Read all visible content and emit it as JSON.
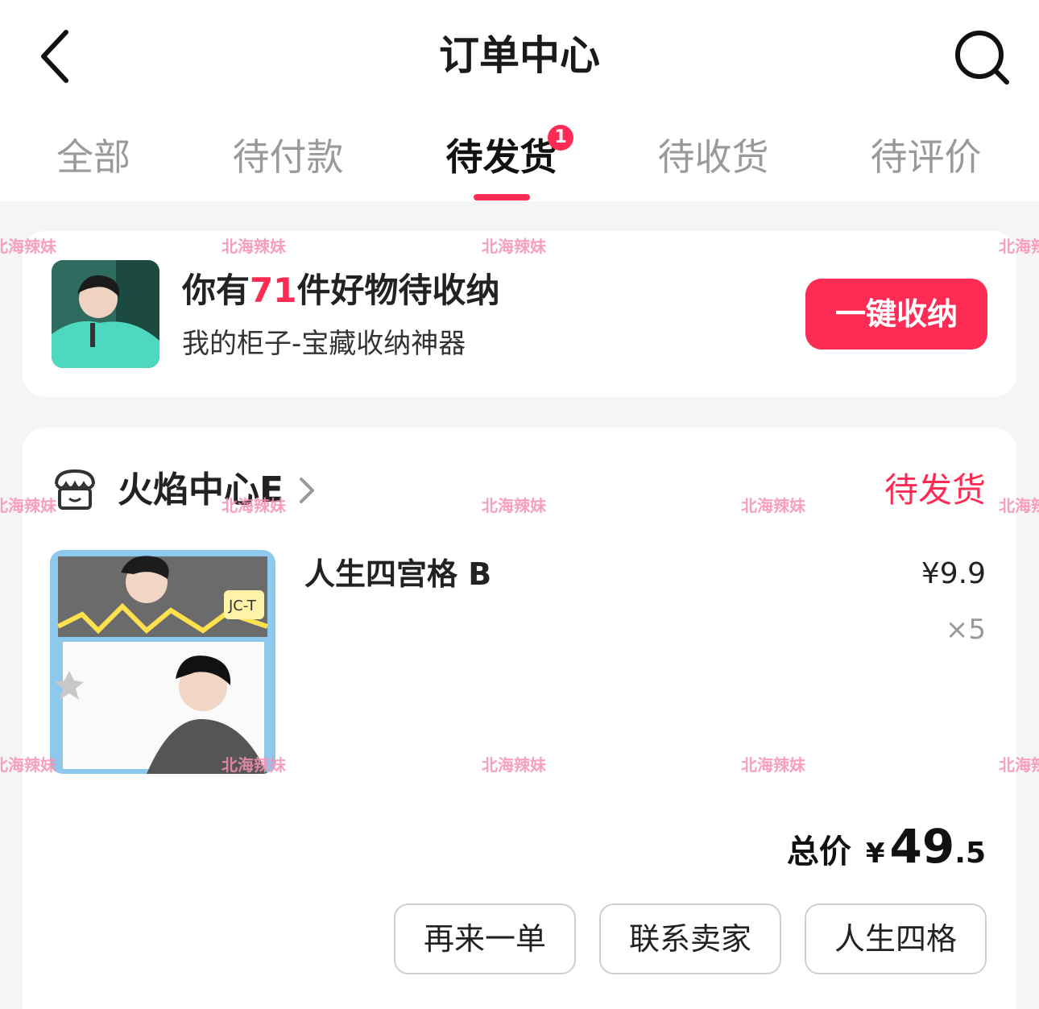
{
  "header": {
    "title": "订单中心",
    "back_icon": "chevron-left-icon",
    "search_icon": "search-icon"
  },
  "tabs": [
    {
      "label": "全部"
    },
    {
      "label": "待付款"
    },
    {
      "label": "待发货",
      "active": true,
      "badge": "1"
    },
    {
      "label": "待收货"
    },
    {
      "label": "待评价"
    }
  ],
  "banner": {
    "title_prefix": "你有",
    "count": "71",
    "title_suffix": "件好物待收纳",
    "subtitle": "我的柜子-宝藏收纳神器",
    "button": "一键收纳"
  },
  "order": {
    "shop_name": "火焰中心E",
    "status": "待发货",
    "product": {
      "name": "人生四宫格 B",
      "price": "¥9.9",
      "quantity": "×5",
      "image_text": "JC-T"
    },
    "total": {
      "label": "总价",
      "currency": "¥",
      "integer": "49",
      "decimal": ".5"
    },
    "actions": [
      "再来一单",
      "联系卖家",
      "人生四格"
    ]
  },
  "watermark": "北海辣妹",
  "colors": {
    "accent": "#fe2c55",
    "background": "#f5f5f5",
    "card": "#ffffff",
    "muted_text": "#9a9a9a"
  }
}
